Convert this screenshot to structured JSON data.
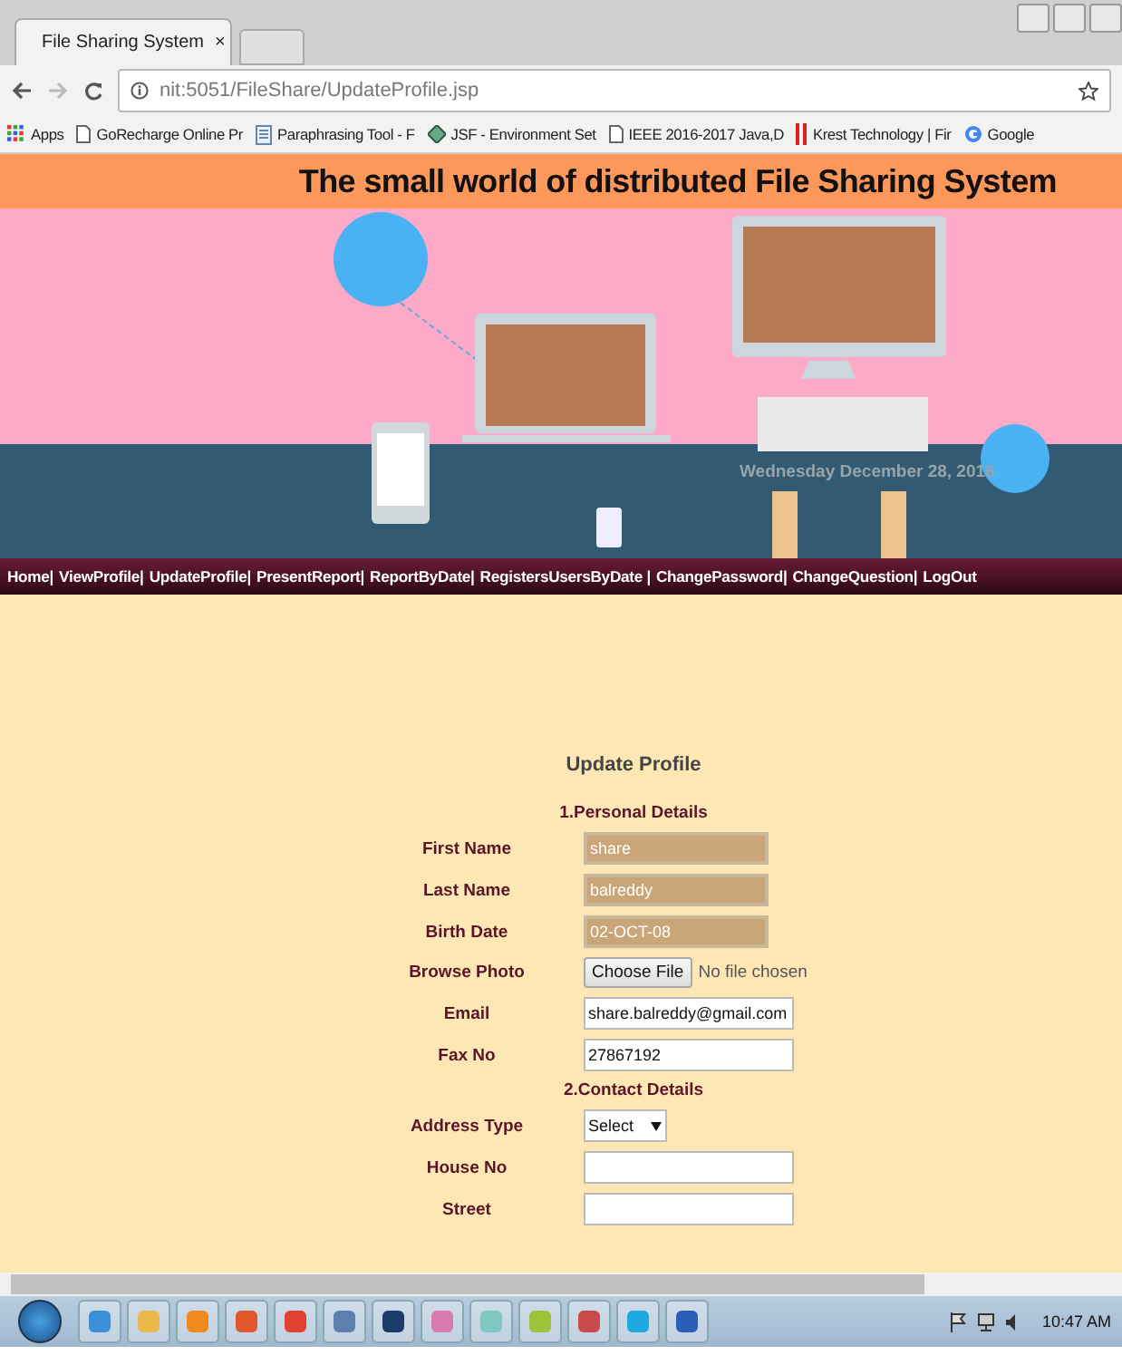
{
  "browser": {
    "tab_title": "File Sharing System",
    "tab_close": "×",
    "address": "nit:5051/FileShare/UpdateProfile.jsp",
    "bookmarks": [
      {
        "label": "Apps",
        "kind": "apps"
      },
      {
        "label": "GoRecharge Online Pr",
        "kind": "page"
      },
      {
        "label": "Paraphrasing Tool - F",
        "kind": "doc"
      },
      {
        "label": "JSF - Environment Set",
        "kind": "diamond"
      },
      {
        "label": "IEEE 2016-2017 Java,D",
        "kind": "page"
      },
      {
        "label": "Krest Technology | Fir",
        "kind": "bars"
      },
      {
        "label": "Google",
        "kind": "google"
      }
    ]
  },
  "header": {
    "title": "The small world of distributed File Sharing System",
    "date": "Wednesday December 28, 2016"
  },
  "nav": [
    "Home|",
    "ViewProfile|",
    "UpdateProfile|",
    "PresentReport|",
    "ReportByDate|",
    "RegistersUsersByDate |",
    "ChangePassword|",
    "ChangeQuestion|",
    "LogOut"
  ],
  "form": {
    "title": "Update Profile",
    "rows": [
      {
        "kind": "section",
        "label": "1.Personal Details"
      },
      {
        "kind": "readonly",
        "label": "First Name",
        "value": "share"
      },
      {
        "kind": "readonly",
        "label": "Last Name",
        "value": "balreddy"
      },
      {
        "kind": "readonly",
        "label": "Birth Date",
        "value": "02-OCT-08"
      },
      {
        "kind": "file",
        "label": "Browse Photo",
        "button": "Choose File",
        "value": "No file chosen"
      },
      {
        "kind": "text",
        "label": "Email",
        "value": "share.balreddy@gmail.com"
      },
      {
        "kind": "text",
        "label": "Fax No",
        "value": "27867192"
      },
      {
        "kind": "section",
        "label": "2.Contact Details"
      },
      {
        "kind": "select",
        "label": "Address Type",
        "value": "Select"
      },
      {
        "kind": "text",
        "label": "House No"
      },
      {
        "kind": "text",
        "label": "Street"
      }
    ]
  },
  "taskbar": {
    "clock": "10:47 AM"
  }
}
